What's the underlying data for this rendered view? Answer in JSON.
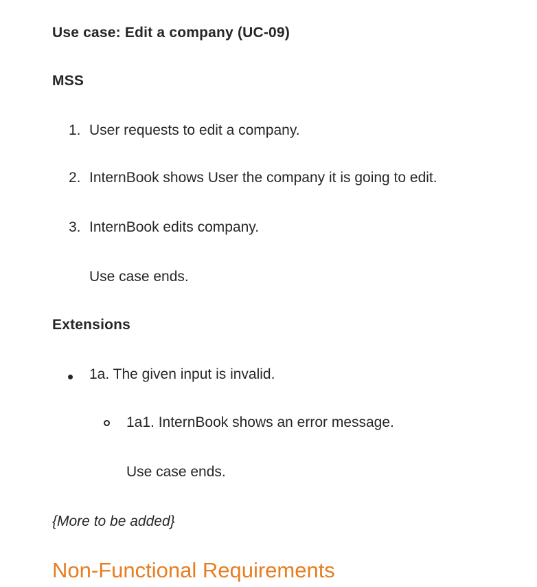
{
  "use_case": {
    "title": "Use case: Edit a company (UC-09)",
    "mss_heading": "MSS",
    "mss_steps": [
      {
        "number": "1.",
        "text": "User requests to edit a company."
      },
      {
        "number": "2.",
        "text": "InternBook shows User the company it is going to edit."
      },
      {
        "number": "3.",
        "text": "InternBook edits company."
      }
    ],
    "mss_end": "Use case ends.",
    "extensions_heading": "Extensions",
    "extensions": [
      {
        "text": "1a. The given input is invalid.",
        "sub": [
          {
            "text": "1a1. InternBook shows an error message.",
            "end": "Use case ends."
          }
        ]
      }
    ],
    "more_note": "{More to be added}"
  },
  "next_section": {
    "heading": "Non-Functional Requirements",
    "color": "#e67e22"
  }
}
